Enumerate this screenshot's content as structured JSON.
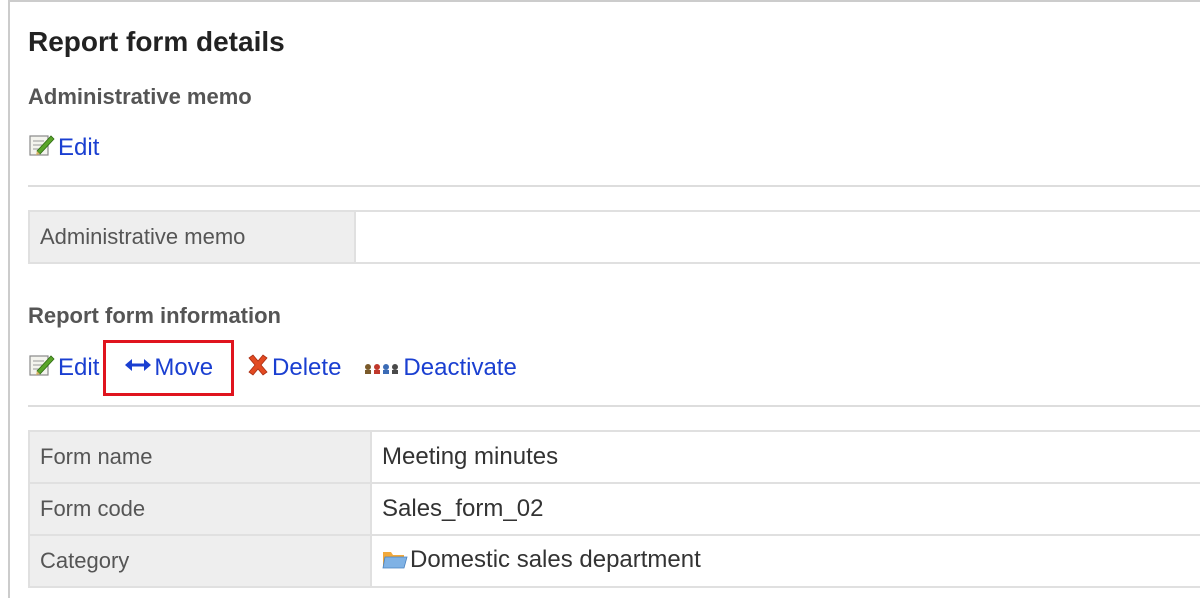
{
  "page_title": "Report form details",
  "memo_section": {
    "title": "Administrative memo",
    "edit_label": "Edit",
    "table": [
      {
        "label": "Administrative memo",
        "value": ""
      }
    ]
  },
  "info_section": {
    "title": "Report form information",
    "actions": {
      "edit_label": "Edit",
      "move_label": "Move",
      "delete_label": "Delete",
      "deactivate_label": "Deactivate"
    },
    "rows": [
      {
        "label": "Form name",
        "value": "Meeting minutes"
      },
      {
        "label": "Form code",
        "value": "Sales_form_02"
      },
      {
        "label": "Category",
        "value": "Domestic sales department"
      }
    ]
  },
  "colors": {
    "link": "#1a3fd1",
    "highlight_border": "#e0141e",
    "label_bg": "#eeeeee"
  },
  "icons": [
    "edit-icon",
    "move-arrows-icon",
    "delete-x-icon",
    "deactivate-icon",
    "folder-icon"
  ]
}
